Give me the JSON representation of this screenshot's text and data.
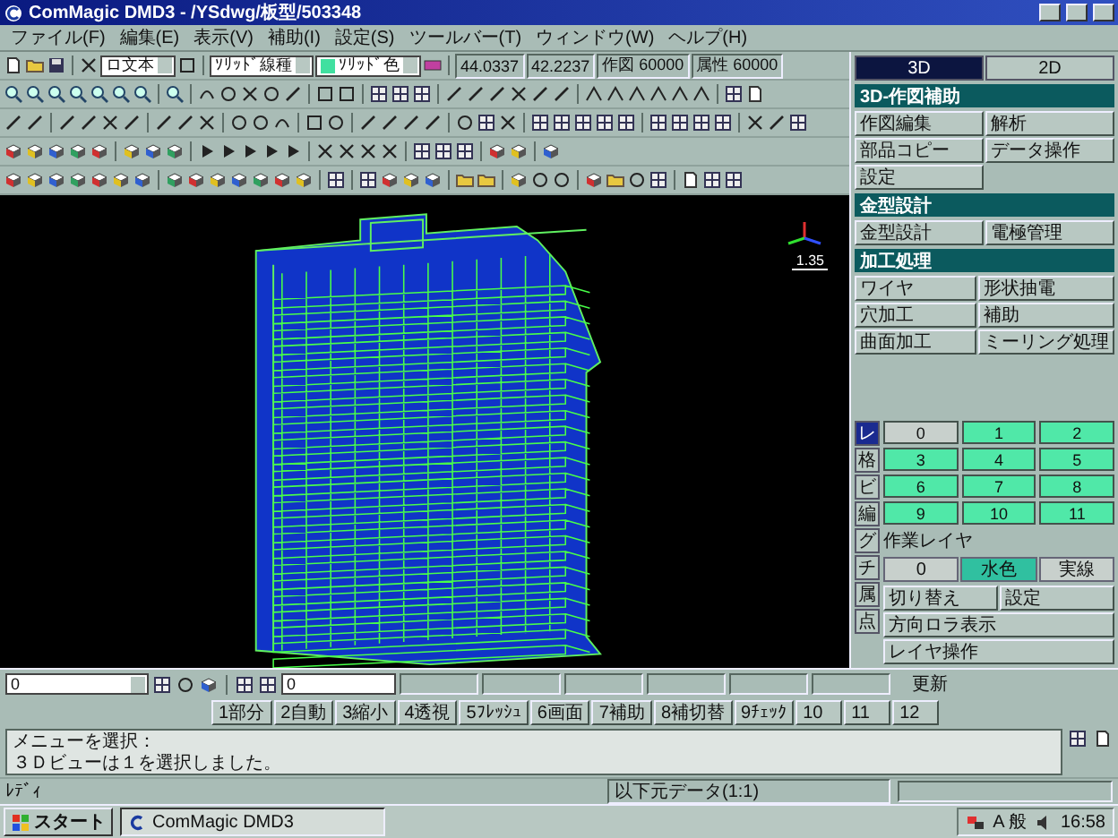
{
  "window": {
    "title": "ComMagic DMD3 - /YSdwg/板型/503348"
  },
  "menu": [
    "ファイル(F)",
    "編集(E)",
    "表示(V)",
    "補助(I)",
    "設定(S)",
    "ツールバー(T)",
    "ウィンドウ(W)",
    "ヘルプ(H)"
  ],
  "toolbar": {
    "font_combo": "ロ文本",
    "line_type_combo": "ｿﾘｯﾄﾞ線種",
    "line_color_combo": "ｿﾘｯﾄﾞ色",
    "readouts": [
      "44.0337",
      "42.2237",
      "作図 60000",
      "属性 60000"
    ]
  },
  "side_panel": {
    "tabs": [
      {
        "label": "3D",
        "selected": true
      },
      {
        "label": "2D",
        "selected": false
      }
    ],
    "sections": [
      {
        "title": "3D-作図補助",
        "buttons": [
          "作図編集",
          "解析",
          "部品コピー",
          "データ操作",
          "設定"
        ]
      },
      {
        "title": "金型設計",
        "buttons": [
          "金型設計",
          "電極管理"
        ]
      },
      {
        "title": "加工処理",
        "buttons": [
          "ワイヤ",
          "形状抽電",
          "穴加工",
          "補助",
          "曲面加工",
          "ミーリング処理"
        ]
      }
    ]
  },
  "layer_panel": {
    "side_tabs": [
      {
        "label": "レ",
        "selected": true
      },
      {
        "label": "格",
        "selected": false
      },
      {
        "label": "ビ",
        "selected": false
      },
      {
        "label": "編",
        "selected": false
      },
      {
        "label": "グ",
        "selected": false
      },
      {
        "label": "チ",
        "selected": false
      },
      {
        "label": "属",
        "selected": false
      },
      {
        "label": "点",
        "selected": false
      }
    ],
    "layers": [
      {
        "label": "0",
        "on": false
      },
      {
        "label": "1",
        "on": true
      },
      {
        "label": "2",
        "on": true
      },
      {
        "label": "3",
        "on": true
      },
      {
        "label": "4",
        "on": true
      },
      {
        "label": "5",
        "on": true
      },
      {
        "label": "6",
        "on": true
      },
      {
        "label": "7",
        "on": true
      },
      {
        "label": "8",
        "on": true
      },
      {
        "label": "9",
        "on": true
      },
      {
        "label": "10",
        "on": true
      },
      {
        "label": "11",
        "on": true
      }
    ],
    "work_layer_title": "作業レイヤ",
    "work_layer": [
      {
        "label": "0",
        "selected": false
      },
      {
        "label": "水色",
        "selected": true
      },
      {
        "label": "実線",
        "selected": false
      }
    ],
    "buttons": [
      "切り替え",
      "設定",
      "方向ロラ表示",
      "レイヤ操作"
    ]
  },
  "viewport": {
    "scale_label": "1.35"
  },
  "command_bar": {
    "layer_combo": "0",
    "input": "0",
    "apply_button": "更新"
  },
  "function_keys": [
    "1部分",
    "2自動",
    "3縮小",
    "4透視",
    "5ﾌﾚｯｼｭ",
    "6画面",
    "7補助",
    "8補切替",
    "9ﾁｪｯｸ",
    "10",
    "11",
    "12"
  ],
  "messages": [
    "メニューを選択：",
    "３Ｄビューは１を選択しました。"
  ],
  "status_bar": {
    "left": "ﾚﾃﾞｨ",
    "right": "以下元データ(1:1)"
  },
  "taskbar": {
    "start": "スタート",
    "tasks": [
      "ComMagic DMD3"
    ],
    "ime": "A 般",
    "clock": "16:58"
  }
}
